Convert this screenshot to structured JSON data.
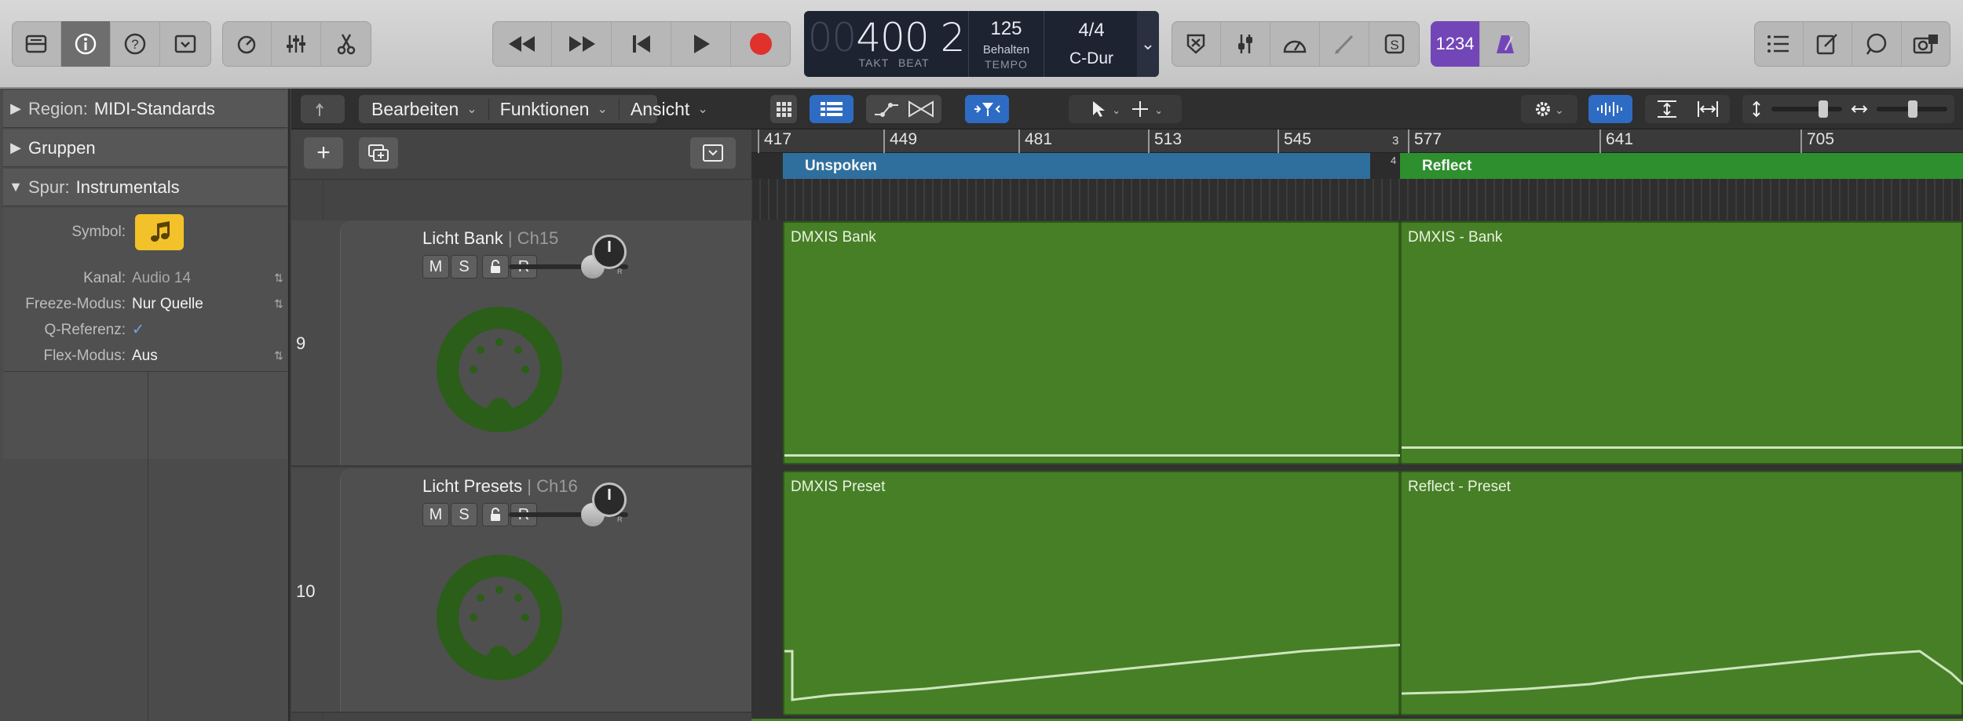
{
  "toolbar": {
    "left_group": [
      "library-icon",
      "info-icon",
      "help-icon",
      "toolbox-icon"
    ],
    "mid_group": [
      "smart-controls-icon",
      "mixer-icon",
      "scissors-icon"
    ],
    "transport": [
      "rewind-icon",
      "fast-forward-icon",
      "go-to-start-icon",
      "play-icon",
      "record-icon"
    ],
    "right_group": [
      "replace-icon",
      "tuner-icon",
      "speedometer-icon",
      "pencil-icon",
      "solo-icon"
    ],
    "count_in_label": "1234",
    "far_right": [
      "list-editors-icon",
      "notepad-icon",
      "loop-browser-icon",
      "media-browser-icon"
    ]
  },
  "lcd": {
    "takt_dim": "00",
    "takt": "400",
    "beat": "2",
    "takt_label": "TAKT",
    "beat_label": "BEAT",
    "tempo": "125",
    "tempo_mode": "Behalten",
    "tempo_label": "TEMPO",
    "signature": "4/4",
    "key": "C-Dur"
  },
  "inspector": {
    "region_label": "Region:",
    "region_value": "MIDI-Standards",
    "gruppen": "Gruppen",
    "spur_label": "Spur:",
    "spur_value": "Instrumentals",
    "symbol_label": "Symbol:",
    "props": [
      {
        "k": "Kanal:",
        "v": "Audio 14"
      },
      {
        "k": "Freeze-Modus:",
        "v": "Nur Quelle"
      },
      {
        "k": "Q-Referenz:",
        "v": "✓"
      },
      {
        "k": "Flex-Modus:",
        "v": "Aus"
      }
    ]
  },
  "arrange_toolbar": {
    "menus": [
      "Bearbeiten",
      "Funktionen",
      "Ansicht"
    ]
  },
  "ruler": [
    "417",
    "449",
    "481",
    "513",
    "545",
    "577",
    "641",
    "705"
  ],
  "ruler_small": [
    "3",
    "4"
  ],
  "markers": [
    {
      "name": "Unspoken",
      "color": "#2f6f9e"
    },
    {
      "name": "Reflect",
      "color": "#2e8f2e"
    }
  ],
  "tracks": [
    {
      "num": "9",
      "name": "Licht Bank",
      "ch": "| Ch15",
      "regions": [
        "DMXIS Bank",
        "DMXIS - Bank"
      ]
    },
    {
      "num": "10",
      "name": "Licht Presets",
      "ch": "| Ch16",
      "regions": [
        "DMXIS Preset",
        "Reflect - Preset"
      ]
    }
  ],
  "mute": "M",
  "solo": "S",
  "record": "R",
  "pan_l": "L",
  "pan_r": "R"
}
